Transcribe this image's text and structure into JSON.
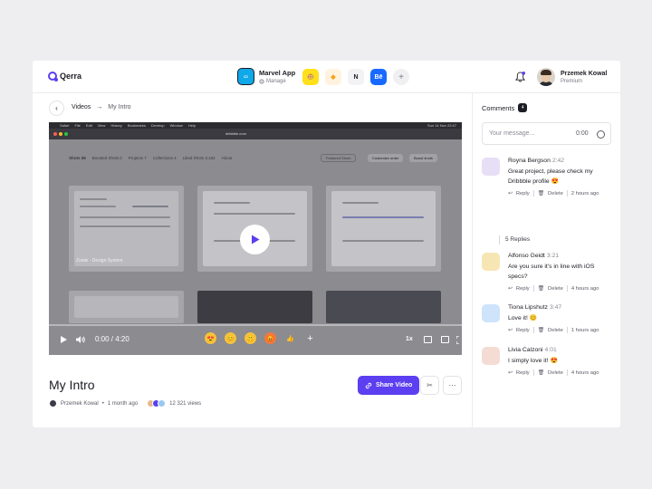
{
  "header": {
    "logo": "Qerra",
    "app": {
      "name": "Marvel App",
      "manage": "Manage"
    },
    "integrations": [
      "mailchimp",
      "sketch",
      "notion",
      "behance"
    ],
    "user": {
      "name": "Przemek Kowal",
      "plan": "Premium"
    }
  },
  "breadcrumb": {
    "parent": "Videos",
    "current": "My Intro"
  },
  "player": {
    "current_time": "0:00",
    "duration": "4:20",
    "speed": "1x",
    "card_title": "Zowie - Design System",
    "browser_url": "dribbble.com",
    "menubar": [
      "Safari",
      "File",
      "Edit",
      "View",
      "History",
      "Bookmarks",
      "Develop",
      "Window",
      "Help"
    ],
    "menubar_time": "Sun 14 Nov 22:47",
    "tabs": [
      "Shots 58",
      "Boosted Shots 0",
      "Projects 7",
      "Collections 4",
      "Liked Shots 3.162",
      "About"
    ],
    "tab_buttons": [
      "Featured Shots",
      "Customize order",
      "Boost shots"
    ]
  },
  "video": {
    "title": "My Intro",
    "author": "Przemek Kowal",
    "posted": "1 month ago",
    "views": "12 321 views",
    "share_label": "Share Video"
  },
  "comments": {
    "heading": "Comments",
    "count": "4",
    "placeholder": "Your message...",
    "timer": "0:00",
    "items": [
      {
        "name": "Royna Bergson",
        "time": "2:42",
        "text": "Great project, please check my Dribbble profile 😍",
        "reply": "Reply",
        "delete": "Delete",
        "ago": "2 hours ago",
        "color": "#e6dff5"
      },
      {
        "name": "Alfonso Geidt",
        "time": "3:21",
        "text": "Are you sure it's in line with iOS specs?",
        "reply": "Reply",
        "delete": "Delete",
        "ago": "4 hours ago",
        "color": "#f6e6b4"
      },
      {
        "name": "Tiona Lipshutz",
        "time": "3:47",
        "text": "Love it! 😊",
        "reply": "Reply",
        "delete": "Delete",
        "ago": "1 hours ago",
        "color": "#cde4fb"
      },
      {
        "name": "Livia Calzoni",
        "time": "4:01",
        "text": "I simply love it! 😍",
        "reply": "Reply",
        "delete": "Delete",
        "ago": "4 hours ago",
        "color": "#f4dcd5"
      }
    ],
    "replies_label": "5 Replies"
  }
}
